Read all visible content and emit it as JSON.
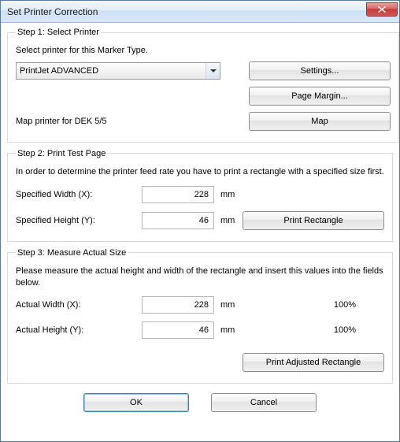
{
  "window": {
    "title": "Set Printer Correction"
  },
  "step1": {
    "legend": "Step 1: Select Printer",
    "instruction": "Select printer for this Marker Type.",
    "printer_selected": "PrintJet ADVANCED",
    "settings_label": "Settings...",
    "page_margin_label": "Page Margin...",
    "map_text": "Map printer for DEK 5/5",
    "map_label": "Map"
  },
  "step2": {
    "legend": "Step 2: Print Test Page",
    "instruction": "In order to determine the printer feed rate you have to print a rectangle with a specified size first.",
    "spec_width_label": "Specified Width (X):",
    "spec_width_value": "228",
    "spec_height_label": "Specified Height (Y):",
    "spec_height_value": "46",
    "unit": "mm",
    "print_rect_label": "Print Rectangle"
  },
  "step3": {
    "legend": "Step 3: Measure Actual Size",
    "instruction": "Please measure the actual height and width of the rectangle and insert this values into the fields below.",
    "actual_width_label": "Actual Width (X):",
    "actual_width_value": "228",
    "actual_width_pct": "100%",
    "actual_height_label": "Actual Height (Y):",
    "actual_height_value": "46",
    "actual_height_pct": "100%",
    "unit": "mm",
    "print_adj_label": "Print Adjusted Rectangle"
  },
  "buttons": {
    "ok": "OK",
    "cancel": "Cancel"
  }
}
